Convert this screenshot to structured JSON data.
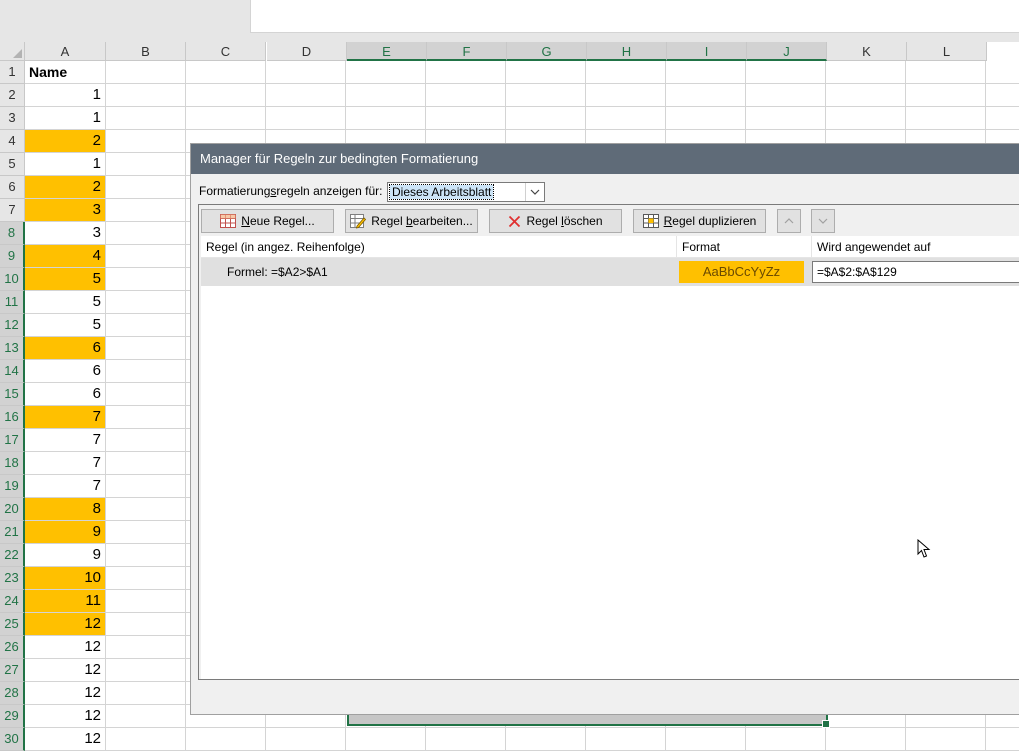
{
  "columns": [
    "A",
    "B",
    "C",
    "D",
    "E",
    "F",
    "G",
    "H",
    "I",
    "J",
    "K",
    "L"
  ],
  "selected_columns": [
    "E",
    "F",
    "G",
    "H",
    "I",
    "J"
  ],
  "selected_rows": [
    8,
    9,
    10,
    11,
    12,
    13,
    14,
    15,
    16,
    17,
    18,
    19,
    20,
    21,
    22,
    23,
    24,
    25,
    26,
    27,
    28,
    29,
    30
  ],
  "rows": [
    {
      "n": "1",
      "a": "Name",
      "header": true,
      "hl": false
    },
    {
      "n": "2",
      "a": "1",
      "hl": false
    },
    {
      "n": "3",
      "a": "1",
      "hl": false
    },
    {
      "n": "4",
      "a": "2",
      "hl": true
    },
    {
      "n": "5",
      "a": "1",
      "hl": false
    },
    {
      "n": "6",
      "a": "2",
      "hl": true
    },
    {
      "n": "7",
      "a": "3",
      "hl": true
    },
    {
      "n": "8",
      "a": "3",
      "hl": false
    },
    {
      "n": "9",
      "a": "4",
      "hl": true
    },
    {
      "n": "10",
      "a": "5",
      "hl": true
    },
    {
      "n": "11",
      "a": "5",
      "hl": false
    },
    {
      "n": "12",
      "a": "5",
      "hl": false
    },
    {
      "n": "13",
      "a": "6",
      "hl": true
    },
    {
      "n": "14",
      "a": "6",
      "hl": false
    },
    {
      "n": "15",
      "a": "6",
      "hl": false
    },
    {
      "n": "16",
      "a": "7",
      "hl": true
    },
    {
      "n": "17",
      "a": "7",
      "hl": false
    },
    {
      "n": "18",
      "a": "7",
      "hl": false
    },
    {
      "n": "19",
      "a": "7",
      "hl": false
    },
    {
      "n": "20",
      "a": "8",
      "hl": true
    },
    {
      "n": "21",
      "a": "9",
      "hl": true
    },
    {
      "n": "22",
      "a": "9",
      "hl": false
    },
    {
      "n": "23",
      "a": "10",
      "hl": true
    },
    {
      "n": "24",
      "a": "11",
      "hl": true
    },
    {
      "n": "25",
      "a": "12",
      "hl": true
    },
    {
      "n": "26",
      "a": "12",
      "hl": false
    },
    {
      "n": "27",
      "a": "12",
      "hl": false
    },
    {
      "n": "28",
      "a": "12",
      "hl": false
    },
    {
      "n": "29",
      "a": "12",
      "hl": false
    },
    {
      "n": "30",
      "a": "12",
      "hl": false
    }
  ],
  "highlight_color": "#ffc000",
  "accent_color": "#217346",
  "dialog": {
    "title": "Manager für Regeln zur bedingten Formatierung",
    "show_label_pre": "Formatierung",
    "show_label_u": "s",
    "show_label_post": "regeln anzeigen für:",
    "show_value": "Dieses Arbeitsblatt",
    "buttons": {
      "new_u": "N",
      "new_rest": "eue Regel...",
      "edit_pre": "Regel ",
      "edit_u": "b",
      "edit_rest": "earbeiten...",
      "delete_pre": "Regel ",
      "delete_u": "l",
      "delete_rest": "öschen",
      "dup_u": "R",
      "dup_rest": "egel duplizieren"
    },
    "list_headers": {
      "rule": "Regel (in angez. Reihenfolge)",
      "format": "Format",
      "applies": "Wird angewendet auf"
    },
    "rule": {
      "formula": "Formel: =$A2>$A1",
      "format_preview": "AaBbCcYyZz",
      "applies_to": "=$A$2:$A$129"
    }
  }
}
